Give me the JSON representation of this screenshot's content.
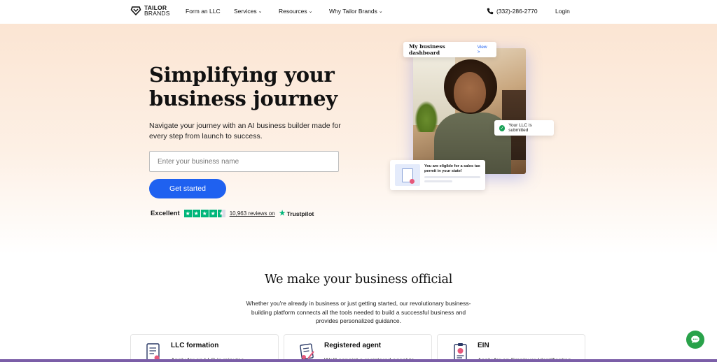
{
  "nav": {
    "logo_line1": "TAILOR",
    "logo_line2": "BRANDS",
    "items": [
      {
        "label": "Form an LLC"
      },
      {
        "label": "Services"
      },
      {
        "label": "Resources"
      },
      {
        "label": "Why Tailor Brands"
      }
    ],
    "phone": "(332)-286-2770",
    "login": "Login"
  },
  "hero": {
    "title": "Simplifying your business journey",
    "subtitle": "Navigate your journey with an AI business builder made for every step from launch to success.",
    "input_placeholder": "Enter your business name",
    "cta": "Get started",
    "trustpilot": {
      "rating_word": "Excellent",
      "stars": 4.5,
      "reviews": "10,963 reviews on",
      "brand": "Trustpilot"
    },
    "collage": {
      "dashboard_title": "My business dashboard",
      "dashboard_link": "View >",
      "llc_status": "Your LLC is submitted",
      "tax_notice": "You are eligible for a sales tax permit in your state!"
    }
  },
  "official": {
    "title": "We make your business official",
    "subtitle": "Whether you're already in business or just getting started, our revolutionary business-building platform connects all the tools needed to build a successful business and provides personalized guidance."
  },
  "features": [
    {
      "title": "LLC formation",
      "desc": "Apply for an LLC in minutes"
    },
    {
      "title": "Registered agent",
      "desc": "We'll appoint a registered agent to"
    },
    {
      "title": "EIN",
      "desc": "Apply for an Employer Identification"
    }
  ],
  "colors": {
    "accent_blue": "#1f61f0",
    "trustpilot_green": "#00b67a",
    "chat_green": "#29a24a"
  }
}
